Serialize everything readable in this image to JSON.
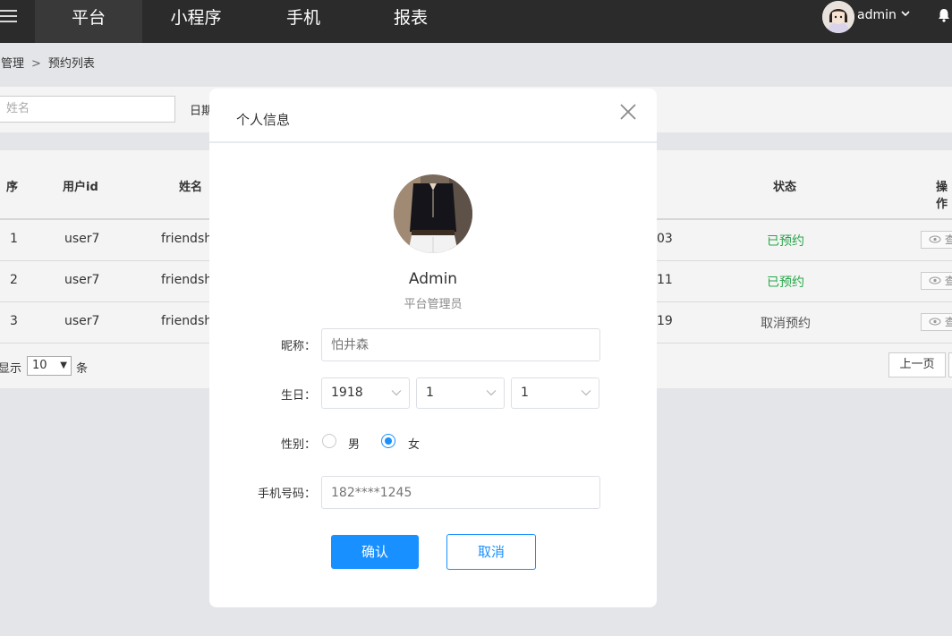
{
  "nav": {
    "items": [
      "平台",
      "小程序",
      "手机",
      "报表"
    ],
    "user": "admin"
  },
  "breadcrumb": {
    "parent": "户管理",
    "separator": ">",
    "current": "预约列表"
  },
  "filter": {
    "name_placeholder": "姓名",
    "date_label": "日期"
  },
  "table": {
    "headers": {
      "index": "序",
      "user_id": "用户id",
      "name": "姓名",
      "status": "状态",
      "action": "操作"
    },
    "rows": [
      {
        "index": "1",
        "user_id": "user7",
        "name": "friendsh",
        "date_tail": "03",
        "status": "已预约",
        "action": "查"
      },
      {
        "index": "2",
        "user_id": "user7",
        "name": "friendsh",
        "date_tail": "11",
        "status": "已预约",
        "action": "查"
      },
      {
        "index": "3",
        "user_id": "user7",
        "name": "friendsh",
        "date_tail": "19",
        "status": "取消预约",
        "action": "查"
      }
    ]
  },
  "pager": {
    "show": "显示",
    "size": "10",
    "unit": "条",
    "prev": "上一页"
  },
  "modal": {
    "title": "个人信息",
    "profile_name": "Admin",
    "profile_role": "平台管理员",
    "nickname_label": "昵称：",
    "nickname_placeholder": "怕井森",
    "birthday_label": "生日：",
    "birth_year": "1918",
    "birth_month": "1",
    "birth_day": "1",
    "gender_label": "性别：",
    "gender_male": "男",
    "gender_female": "女",
    "gender_selected": "女",
    "phone_label": "手机号码：",
    "phone_placeholder": "182****1245",
    "confirm": "确认",
    "cancel": "取消"
  },
  "colors": {
    "accent": "#1890ff",
    "topbar": "#2b2b2b",
    "status_ok": "#27a64a"
  },
  "icons": [
    "menu-icon",
    "avatar-image",
    "chevron-down-icon",
    "bell-icon",
    "close-icon",
    "eye-icon"
  ]
}
